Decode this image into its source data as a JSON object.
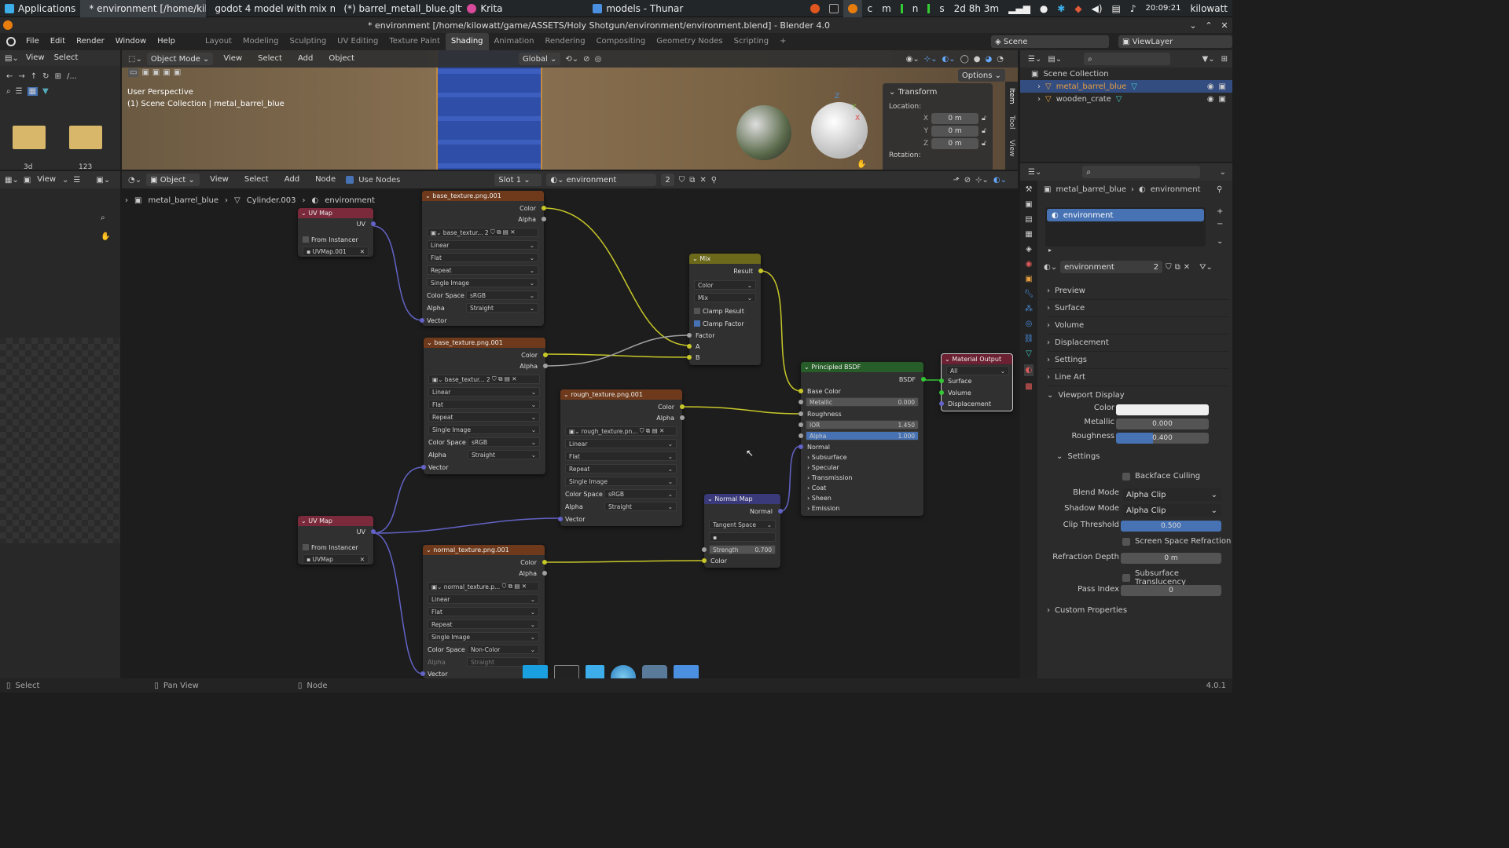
{
  "taskbar": {
    "apps": "Applications",
    "windows": [
      {
        "label": "* environment [/home/kil...",
        "color": "#e87d0d"
      },
      {
        "label": "godot 4 model with mix m...",
        "color": "#e0561f"
      },
      {
        "label": "(*) barrel_metall_blue.gltf...",
        "color": "#4a90d9"
      },
      {
        "label": "Krita",
        "color": "#d84a9a"
      },
      {
        "label": "models - Thunar",
        "color": "#4a8fe0"
      }
    ],
    "status_text": "2d 8h 3m",
    "clock": "20:09:21",
    "user": "kilowatt",
    "letters": [
      "c",
      "m",
      "n",
      "s"
    ]
  },
  "title": "* environment [/home/kilowatt/game/ASSETS/Holy Shotgun/environment/environment.blend] - Blender 4.0",
  "menu": [
    "File",
    "Edit",
    "Render",
    "Window",
    "Help"
  ],
  "workspaces": [
    "Layout",
    "Modeling",
    "Sculpting",
    "UV Editing",
    "Texture Paint",
    "Shading",
    "Animation",
    "Rendering",
    "Compositing",
    "Geometry Nodes",
    "Scripting"
  ],
  "active_workspace": "Shading",
  "scene": "Scene",
  "view_layer": "ViewLayer",
  "filebrowser": {
    "menu": [
      "View",
      "Select"
    ],
    "folders": [
      "3d",
      "123"
    ]
  },
  "viewport": {
    "mode": "Object Mode",
    "menu": [
      "View",
      "Select",
      "Add",
      "Object"
    ],
    "orientation": "Global",
    "options": "Options",
    "overlay1": "User Perspective",
    "overlay2": "(1) Scene Collection | metal_barrel_blue",
    "transform": {
      "title": "Transform",
      "location": "Location:",
      "x": "0 m",
      "y": "0 m",
      "z": "0 m",
      "rotation": "Rotation:"
    },
    "tabs": [
      "Item",
      "Tool",
      "View"
    ]
  },
  "node_editor": {
    "header": {
      "object": "Object",
      "menu": [
        "View",
        "Select",
        "Add",
        "Node"
      ],
      "use_nodes": "Use Nodes",
      "slot": "Slot 1",
      "material": "environment",
      "users": "2"
    },
    "breadcrumb": [
      "metal_barrel_blue",
      "Cylinder.003",
      "environment"
    ],
    "left_view": "View"
  },
  "nodes": {
    "uvmap1": {
      "title": "UV Map",
      "out": "UV",
      "from_instancer": "From Instancer",
      "map": "UVMap.001"
    },
    "uvmap2": {
      "title": "UV Map",
      "out": "UV",
      "from_instancer": "From Instancer",
      "map": "UVMap"
    },
    "tex1": {
      "title": "base_texture.png.001",
      "color": "Color",
      "alpha": "Alpha",
      "img": "base_textur...",
      "users": "2",
      "interp": "Linear",
      "proj": "Flat",
      "ext": "Repeat",
      "src": "Single Image",
      "cs_label": "Color Space",
      "cs": "sRGB",
      "alpha_label": "Alpha",
      "alpha_mode": "Straight",
      "vector": "Vector"
    },
    "tex2": {
      "title": "base_texture.png.001",
      "color": "Color",
      "alpha": "Alpha",
      "img": "base_textur...",
      "users": "2",
      "interp": "Linear",
      "proj": "Flat",
      "ext": "Repeat",
      "src": "Single Image",
      "cs_label": "Color Space",
      "cs": "sRGB",
      "alpha_label": "Alpha",
      "alpha_mode": "Straight",
      "vector": "Vector"
    },
    "tex3": {
      "title": "rough_texture.png.001",
      "color": "Color",
      "alpha": "Alpha",
      "img": "rough_texture.pn...",
      "interp": "Linear",
      "proj": "Flat",
      "ext": "Repeat",
      "src": "Single Image",
      "cs_label": "Color Space",
      "cs": "sRGB",
      "alpha_label": "Alpha",
      "alpha_mode": "Straight",
      "vector": "Vector"
    },
    "tex4": {
      "title": "normal_texture.png.001",
      "color": "Color",
      "alpha": "Alpha",
      "img": "normal_texture.p...",
      "interp": "Linear",
      "proj": "Flat",
      "ext": "Repeat",
      "src": "Single Image",
      "cs_label": "Color Space",
      "cs": "Non-Color",
      "alpha_label": "Alpha",
      "alpha_mode": "Straight",
      "vector": "Vector"
    },
    "mix": {
      "title": "Mix",
      "result": "Result",
      "type": "Color",
      "blend": "Mix",
      "clamp_result": "Clamp Result",
      "clamp_factor": "Clamp Factor",
      "factor": "Factor",
      "a": "A",
      "b": "B"
    },
    "bsdf": {
      "title": "Principled BSDF",
      "out": "BSDF",
      "base_color": "Base Color",
      "metallic": "Metallic",
      "metallic_v": "0.000",
      "roughness": "Roughness",
      "ior": "IOR",
      "ior_v": "1.450",
      "alpha": "Alpha",
      "alpha_v": "1.000",
      "normal": "Normal",
      "panels": [
        "Subsurface",
        "Specular",
        "Transmission",
        "Coat",
        "Sheen",
        "Emission"
      ]
    },
    "output": {
      "title": "Material Output",
      "target": "All",
      "surface": "Surface",
      "volume": "Volume",
      "displacement": "Displacement"
    },
    "normalmap": {
      "title": "Normal Map",
      "out": "Normal",
      "space": "Tangent Space",
      "strength": "Strength",
      "strength_v": "0.700",
      "color": "Color"
    }
  },
  "outliner": {
    "root": "Scene Collection",
    "items": [
      "metal_barrel_blue",
      "wooden_crate"
    ]
  },
  "properties": {
    "breadcrumb": [
      "metal_barrel_blue",
      "environment"
    ],
    "slot": "environment",
    "material": "environment",
    "users": "2",
    "panels": [
      "Preview",
      "Surface",
      "Volume",
      "Displacement",
      "Settings",
      "Line Art",
      "Viewport Display"
    ],
    "vd": {
      "color": "Color",
      "metallic": "Metallic",
      "metallic_v": "0.000",
      "roughness": "Roughness",
      "roughness_v": "0.400",
      "settings": "Settings",
      "backface": "Backface Culling",
      "blend_mode": "Blend Mode",
      "blend_mode_v": "Alpha Clip",
      "shadow_mode": "Shadow Mode",
      "shadow_mode_v": "Alpha Clip",
      "clip": "Clip Threshold",
      "clip_v": "0.500",
      "ssr": "Screen Space Refraction",
      "refr_depth": "Refraction Depth",
      "refr_depth_v": "0 m",
      "sss": "Subsurface Translucency",
      "pass_index": "Pass Index",
      "pass_index_v": "0"
    },
    "custom": "Custom Properties"
  },
  "statusbar": {
    "select": "Select",
    "pan": "Pan View",
    "node": "Node",
    "version": "4.0.1"
  }
}
